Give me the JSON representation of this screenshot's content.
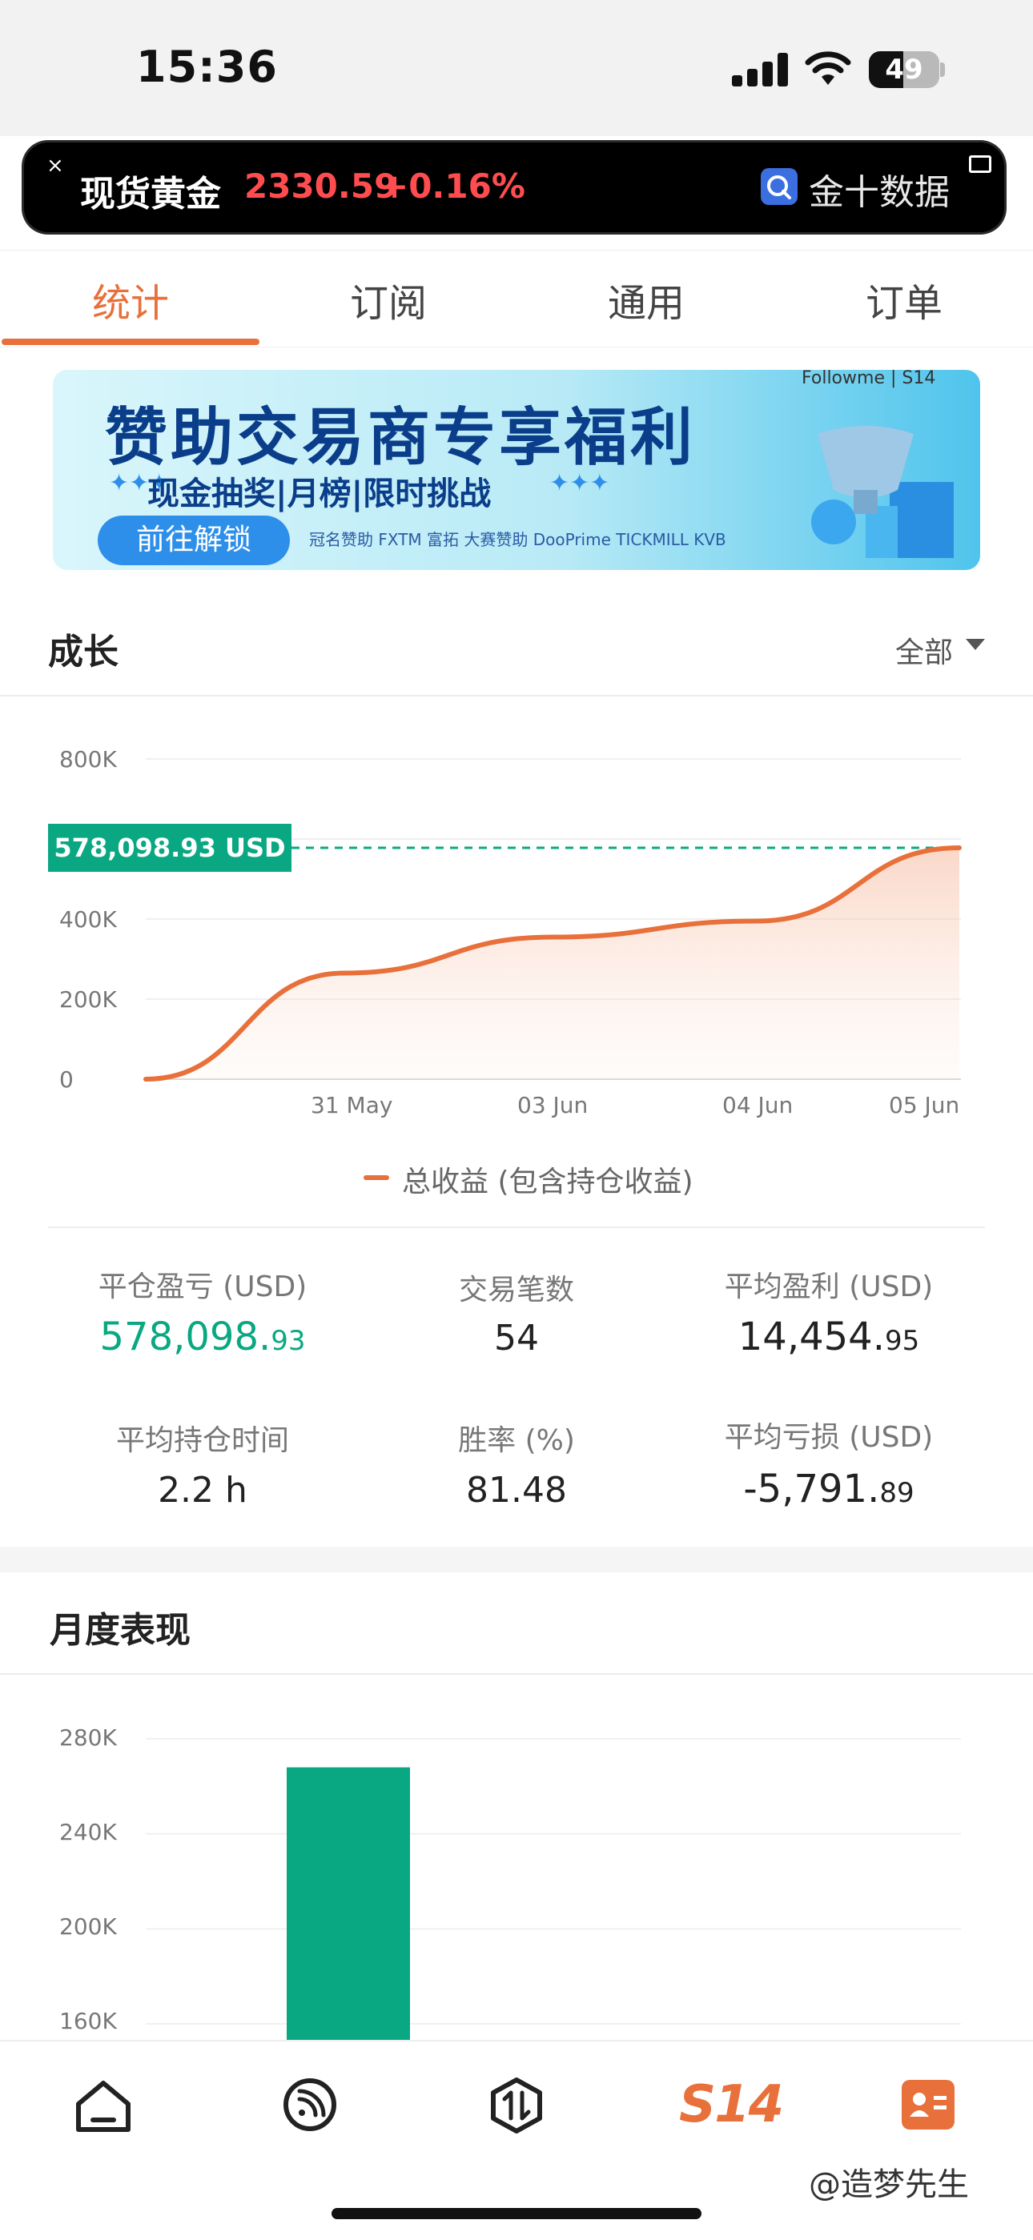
{
  "status_bar": {
    "time": "15:36",
    "battery": "49",
    "battery_level": 0.49
  },
  "ticker": {
    "close_icon": "×",
    "name": "现货黄金",
    "price": "2330.59",
    "change": "+0.16%",
    "brand": "金十数据",
    "colors": {
      "up": "#ff4d4f"
    }
  },
  "tabs": [
    {
      "label": "统计",
      "active": true
    },
    {
      "label": "订阅",
      "active": false
    },
    {
      "label": "通用",
      "active": false
    },
    {
      "label": "订单",
      "active": false
    }
  ],
  "banner": {
    "brand": "Followme | S14",
    "title": "赞助交易商专享福利",
    "subtitle": "现金抽奖|月榜|限时挑战",
    "button": "前往解锁",
    "sponsor_text": "冠名赞助 FXTM 富拓 大赛赞助 DooPrime TICKMILL KVB"
  },
  "growth": {
    "title": "成长",
    "filter": "全部",
    "value_tag": "578,098.93 USD",
    "legend": "总收益 (包含持仓收益)"
  },
  "chart_data": [
    {
      "type": "area",
      "y_ticks": [
        "800K",
        "400K",
        "200K",
        "0"
      ],
      "x_ticks": [
        "31 May",
        "03 Jun",
        "04 Jun",
        "05 Jun"
      ],
      "ylim": [
        0,
        800000
      ],
      "series": [
        {
          "name": "总收益 (包含持仓收益)",
          "color": "#e8703a",
          "points": [
            {
              "x": "start",
              "y": 0
            },
            {
              "x": "31 May",
              "y": 265000
            },
            {
              "x": "03 Jun",
              "y": 355000
            },
            {
              "x": "04 Jun",
              "y": 395000
            },
            {
              "x": "05 Jun",
              "y": 578098.93
            }
          ]
        }
      ],
      "reference_line": {
        "value": 578098.93,
        "label": "578,098.93 USD",
        "color": "#0aa882",
        "style": "dashed"
      }
    },
    {
      "type": "bar",
      "title": "月度表现",
      "y_ticks": [
        "280K",
        "240K",
        "200K",
        "160K"
      ],
      "ylim": [
        160000,
        280000
      ],
      "bars": [
        {
          "value": 268000,
          "color": "#0aa882"
        }
      ]
    }
  ],
  "stats": [
    {
      "label": "平仓盈亏 (USD)",
      "int": "578,098.",
      "dec": "93",
      "color": "#0aa882"
    },
    {
      "label": "交易笔数",
      "int": "54",
      "dec": ""
    },
    {
      "label": "平均盈利 (USD)",
      "int": "14,454.",
      "dec": "95"
    },
    {
      "label": "平均持仓时间",
      "int": "2.2 h",
      "dec": ""
    },
    {
      "label": "胜率 (%)",
      "int": "81.48",
      "dec": ""
    },
    {
      "label": "平均亏损 (USD)",
      "int": "-5,791.",
      "dec": "89"
    }
  ],
  "monthly": {
    "title": "月度表现"
  },
  "bottom_nav": [
    {
      "icon": "home-icon"
    },
    {
      "icon": "feed-icon"
    },
    {
      "icon": "trade-icon"
    },
    {
      "icon": "s14-logo",
      "label": "S14"
    },
    {
      "icon": "profile-card-icon"
    }
  ],
  "watermark": "@造梦先生",
  "colors": {
    "accent": "#e8703a",
    "green": "#0aa882",
    "red": "#ff4d4f"
  }
}
